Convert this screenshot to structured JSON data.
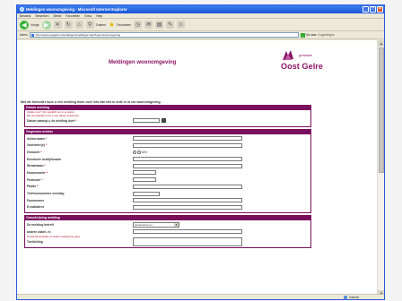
{
  "window": {
    "title": "Meldingen woonomgeving - Microsoft Internet Explorer",
    "minimize": "_",
    "maximize": "□",
    "close": "×"
  },
  "menu": [
    "Bestand",
    "Bewerken",
    "Beeld",
    "Favorieten",
    "Extra",
    "Help"
  ],
  "toolbar": {
    "back_label": "Vorige",
    "search_label": "Zoeken",
    "favorites_label": "Favorieten"
  },
  "address": {
    "label": "Adres",
    "url": "http://www.oostgelre.nl/meldingen/meldingen.asp?type=woonomgeving",
    "go_label": "Ga naar",
    "links_label": "Koppelingen"
  },
  "page": {
    "title": "Meldingen woonomgeving",
    "logo_small": "gemeente",
    "logo_name": "Oost Gelre",
    "intro": "Met dit formulier kunt u een melding doen over iets dat niet in orde is in uw woonomgeving."
  },
  "sections": {
    "datum": {
      "title": "Datum melding",
      "notes": [
        "Velden met * zijn verplicht om in te vullen.",
        "Met de kalender kunt u een datum selecteren."
      ],
      "date_label": "Datum waarop u de melding doet"
    },
    "melder": {
      "title": "Gegevens melder",
      "fields": [
        "Achternaam",
        "Voorletter(s)",
        "Geslacht",
        "Eventuele bedrijfsnaam",
        "Straatnaam",
        "Huisnummer",
        "Postcode",
        "Plaats",
        "Telefoonnummer overdag",
        "Faxnummer",
        "E-mailadres"
      ],
      "gender_value": "M/V"
    },
    "omschrijving": {
      "title": "Omschrijving melding",
      "subject_label": "De melding betreft",
      "subject_value": "speelruimte en",
      "other_label": "andere zaken, nl",
      "note": "Omschrijf duidelijk om welke melding het gaat.",
      "desc_label": "Toelichting"
    }
  },
  "status": {
    "zone": "Internet"
  },
  "colors": {
    "brand": "#7a0f5e",
    "required": "#b0102a"
  }
}
